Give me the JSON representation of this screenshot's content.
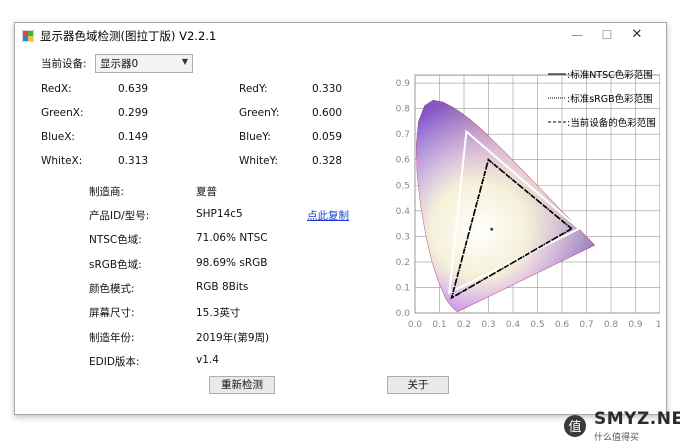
{
  "window": {
    "title": "显示器色域检测(图拉丁版) V2.2.1",
    "min_glyph": "—",
    "max_glyph": "☐",
    "close_glyph": "✕"
  },
  "device": {
    "label": "当前设备:",
    "selected": "显示器0"
  },
  "primaries": [
    {
      "label": "RedX:",
      "value": "0.639"
    },
    {
      "label": "RedY:",
      "value": "0.330"
    },
    {
      "label": "GreenX:",
      "value": "0.299"
    },
    {
      "label": "GreenY:",
      "value": "0.600"
    },
    {
      "label": "BlueX:",
      "value": "0.149"
    },
    {
      "label": "BlueY:",
      "value": "0.059"
    },
    {
      "label": "WhiteX:",
      "value": "0.313"
    },
    {
      "label": "WhiteY:",
      "value": "0.328"
    }
  ],
  "info": [
    {
      "label": "制造商:",
      "value": "夏普"
    },
    {
      "label": "产品ID/型号:",
      "value": "SHP14c5"
    },
    {
      "label": "NTSC色域:",
      "value": "71.06% NTSC"
    },
    {
      "label": "sRGB色域:",
      "value": "98.69% sRGB"
    },
    {
      "label": "颜色模式:",
      "value": "RGB 8Bits"
    },
    {
      "label": "屏幕尺寸:",
      "value": "15.3英寸"
    },
    {
      "label": "制造年份:",
      "value": "2019年(第9周)"
    },
    {
      "label": "EDID版本:",
      "value": "v1.4"
    }
  ],
  "copy_link": "点此复制",
  "buttons": {
    "redetect": "重新检测",
    "about": "关于"
  },
  "watermark": {
    "text": "SMYZ.NET",
    "sub": "什么值得买"
  },
  "chart_data": {
    "type": "scatter",
    "title": "",
    "xlabel": "",
    "ylabel": "",
    "xlim": [
      0,
      1
    ],
    "ylim": [
      0,
      1
    ],
    "x_ticks": [
      "0.0",
      "0.1",
      "0.2",
      "0.3",
      "0.4",
      "0.5",
      "0.6",
      "0.7",
      "0.8",
      "0.9",
      "1."
    ],
    "y_ticks": [
      "0.0",
      "0.1",
      "0.2",
      "0.3",
      "0.4",
      "0.5",
      "0.6",
      "0.7",
      "0.8",
      "0.9"
    ],
    "grid": true,
    "legend_position": "top-right",
    "series": [
      {
        "name": "标准NTSC色彩范围",
        "style": "solid",
        "color": "#ffffff",
        "points": [
          [
            0.67,
            0.33
          ],
          [
            0.21,
            0.71
          ],
          [
            0.14,
            0.08
          ]
        ]
      },
      {
        "name": "标准sRGB色彩范围",
        "style": "dotted",
        "color": "#000000",
        "points": [
          [
            0.64,
            0.33
          ],
          [
            0.3,
            0.6
          ],
          [
            0.15,
            0.06
          ]
        ]
      },
      {
        "name": "当前设备的色彩范围",
        "style": "dashed",
        "color": "#000000",
        "points": [
          [
            0.639,
            0.33
          ],
          [
            0.299,
            0.6
          ],
          [
            0.149,
            0.059
          ]
        ]
      }
    ],
    "legend_labels": [
      ":标准NTSC色彩范围",
      ":标准sRGB色彩范围",
      ":当前设备的色彩范围"
    ],
    "white_point": [
      0.313,
      0.328
    ]
  }
}
